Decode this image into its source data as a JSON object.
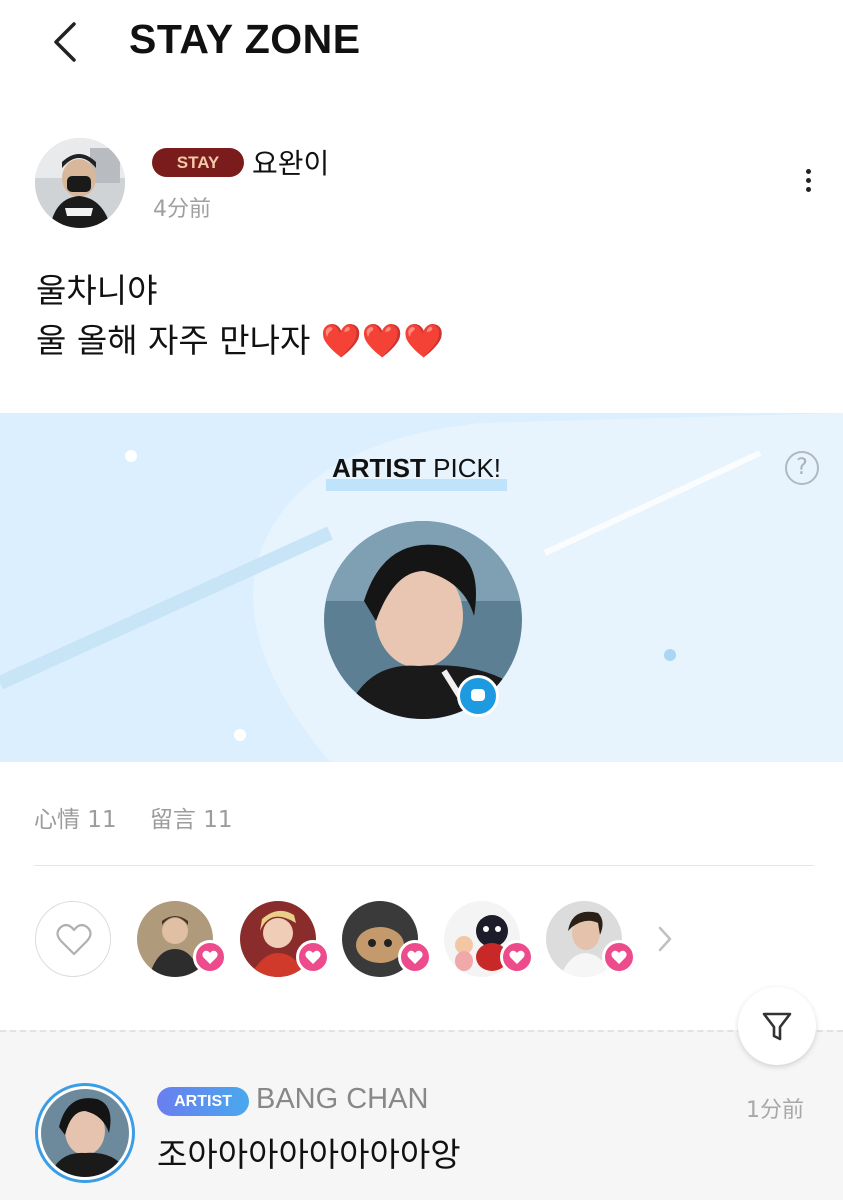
{
  "header": {
    "title": "STAY ZONE",
    "back_icon": "chevron-left-icon"
  },
  "post": {
    "author": {
      "badge": "STAY",
      "name": "요완이",
      "time": "4分前"
    },
    "more_icon": "more-vertical-icon",
    "body_lines": [
      "울차니야",
      "울 올해 자주 만나자 ❤️❤️❤️"
    ]
  },
  "artist_pick": {
    "title_bold": "ARTIST",
    "title_rest": "PICK!",
    "help_label": "?",
    "comment_icon": "comment-bubble-icon"
  },
  "stats": {
    "likes_label": "心情 11",
    "comments_label": "留言 11"
  },
  "likes": {
    "like_icon": "heart-outline-icon",
    "liker_count_shown": 5,
    "next_icon": "chevron-right-icon"
  },
  "comment": {
    "badge": "ARTIST",
    "name": "BANG CHAN",
    "time": "1分前",
    "text": "조아아아아아아아아앙"
  },
  "filter_icon": "filter-icon",
  "colors": {
    "stay_badge_bg": "#7a1c1c",
    "stay_badge_text": "#f3c9a8",
    "banner_bg": "#dcefff",
    "heart_pink": "#ec4c8c",
    "artist_blue": "#3a9de6"
  }
}
